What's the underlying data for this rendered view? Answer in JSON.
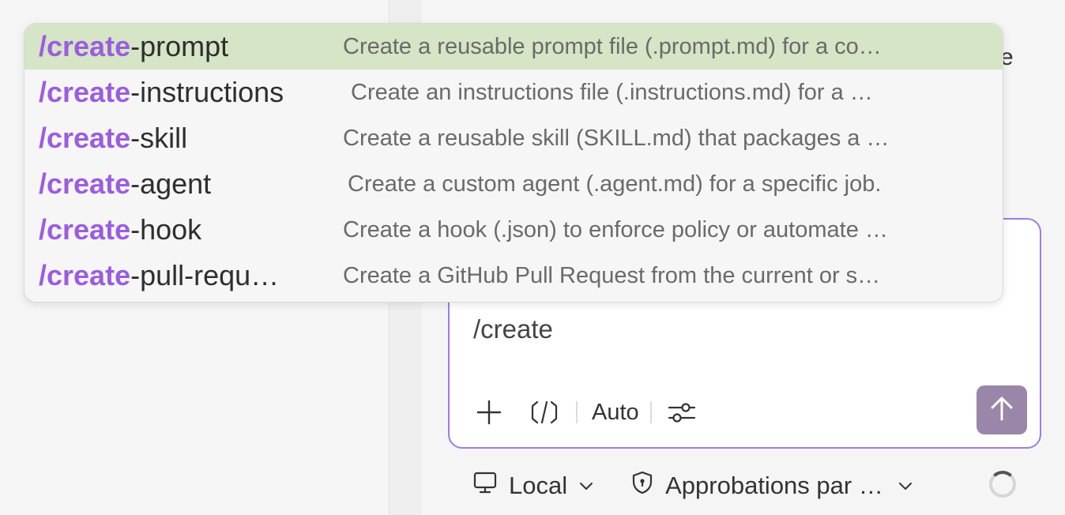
{
  "dropdown": {
    "items": [
      {
        "prefix": "/create",
        "suffix": "-prompt",
        "description": "Create a reusable prompt file (.prompt.md) for a co…",
        "selected": true
      },
      {
        "prefix": "/create",
        "suffix": "-instructions",
        "description": "Create an instructions file (.instructions.md) for a …",
        "selected": false
      },
      {
        "prefix": "/create",
        "suffix": "-skill",
        "description": "Create a reusable skill (SKILL.md) that packages a …",
        "selected": false
      },
      {
        "prefix": "/create",
        "suffix": "-agent",
        "description": "Create a custom agent (.agent.md) for a specific job.",
        "selected": false
      },
      {
        "prefix": "/create",
        "suffix": "-hook",
        "description": "Create a hook (.json) to enforce policy or automate …",
        "selected": false
      },
      {
        "prefix": "/create",
        "suffix": "-pull-requ…",
        "description": "Create a GitHub Pull Request from the current or s…",
        "selected": false
      }
    ]
  },
  "background": {
    "peek_text": "e"
  },
  "composer": {
    "input_value": "/create",
    "mode_label": "Auto",
    "icons": [
      "plus-icon",
      "code-brackets-icon",
      "sliders-icon",
      "arrow-up-icon"
    ]
  },
  "footer": {
    "location_label": "Local",
    "approvals_label": "Approbations par …",
    "icons": [
      "monitor-icon",
      "shield-icon",
      "chevron-down-icon",
      "spinner-icon"
    ]
  },
  "colors": {
    "accent": "#9b5de0",
    "selected_row": "#d5e5c5",
    "composer_border": "#a07be0",
    "send_button": "#9a86a8"
  }
}
